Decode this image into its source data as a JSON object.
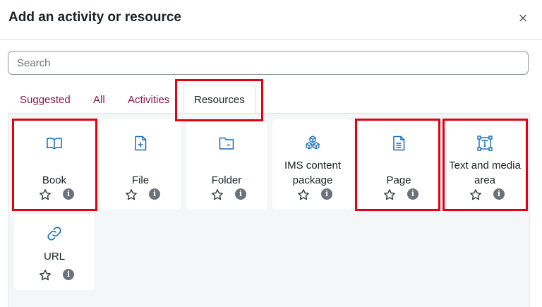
{
  "modal": {
    "title": "Add an activity or resource",
    "close_glyph": "×"
  },
  "search": {
    "placeholder": "Search",
    "value": ""
  },
  "tabs": [
    {
      "label": "Suggested",
      "active": false
    },
    {
      "label": "All",
      "active": false
    },
    {
      "label": "Activities",
      "active": false
    },
    {
      "label": "Resources",
      "active": true
    }
  ],
  "items": [
    {
      "name": "Book",
      "icon": "book-icon"
    },
    {
      "name": "File",
      "icon": "file-add-icon"
    },
    {
      "name": "Folder",
      "icon": "folder-icon"
    },
    {
      "name": "IMS content package",
      "line1": "IMS content",
      "line2": "package",
      "icon": "cubes-icon"
    },
    {
      "name": "Page",
      "icon": "page-icon"
    },
    {
      "name": "Text and media area",
      "line1": "Text and media",
      "line2": "area",
      "icon": "text-box-icon"
    },
    {
      "name": "URL",
      "icon": "link-icon"
    }
  ],
  "info_glyph": "i",
  "colors": {
    "accent": "#8e1a4b",
    "icon": "#0f6cbf",
    "highlight": "#e3000f",
    "panel_bg": "#f5f6f8"
  }
}
